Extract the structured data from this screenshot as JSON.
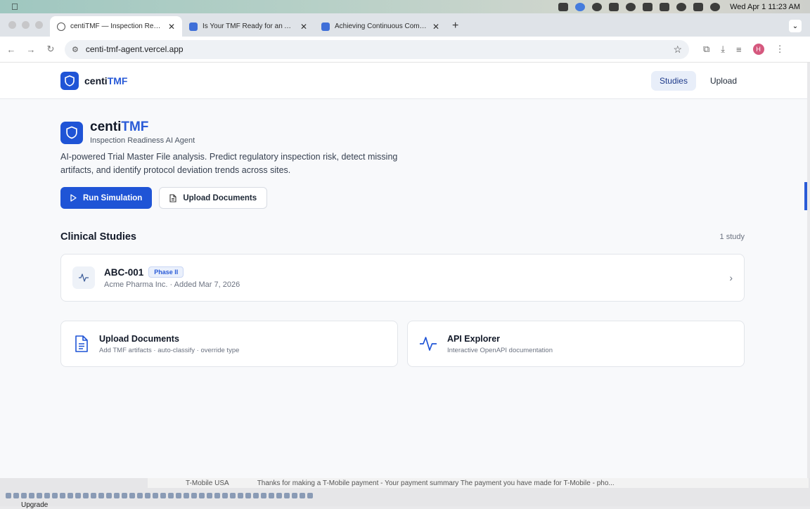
{
  "os": {
    "clock": "Wed Apr 1  11:23 AM"
  },
  "browser": {
    "tabs": [
      {
        "title": "centiTMF — Inspection Readiness AI Agent"
      },
      {
        "title": "Is Your TMF Ready for an Audit"
      },
      {
        "title": "Achieving Continuous Compliance"
      }
    ],
    "url": "centi-tmf-agent.vercel.app",
    "profile_initial": "H"
  },
  "site": {
    "brand_prefix": "centi",
    "brand_suffix": "TMF",
    "nav": [
      {
        "label": "Studies"
      },
      {
        "label": "Upload"
      }
    ]
  },
  "hero": {
    "title_prefix": "centi",
    "title_suffix": "TMF",
    "subtitle": "Inspection Readiness AI Agent",
    "description": "AI-powered Trial Master File analysis. Predict regulatory inspection risk, detect missing artifacts, and identify protocol deviation trends across sites.",
    "primary_button": "Run Simulation",
    "secondary_button": "Upload Documents"
  },
  "studies": {
    "heading": "Clinical Studies",
    "count": "1 study",
    "items": [
      {
        "id": "ABC-001",
        "phase": "Phase II",
        "meta": "Acme Pharma Inc. · Added Mar 7, 2026"
      }
    ]
  },
  "tiles": [
    {
      "title": "Upload Documents",
      "subtitle": "Add TMF artifacts · auto-classify · override type"
    },
    {
      "title": "API Explorer",
      "subtitle": "Interactive OpenAPI documentation"
    }
  ],
  "background_window": {
    "text1": "T-Mobile USA",
    "text2": "Thanks for making a T-Mobile payment - Your payment summary The payment you have made for T-Mobile - pho...",
    "upgrade": "Upgrade"
  },
  "colors": {
    "accent": "#1f54d6",
    "accent_text": "#2a5bd7"
  }
}
